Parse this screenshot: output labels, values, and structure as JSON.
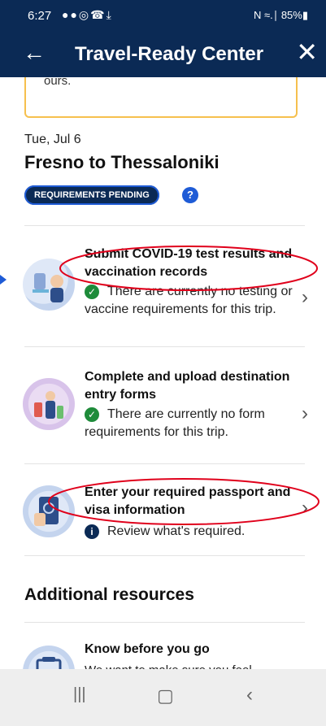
{
  "status": {
    "time": "6:27",
    "left_icons": "●●◎☎⤓",
    "right": "N ≈.∣ 85%▮"
  },
  "header": {
    "back_glyph": "←",
    "title": "Travel-Ready Center",
    "close_glyph": "✕"
  },
  "notice": {
    "text": "ours."
  },
  "trip": {
    "date": "Tue, Jul 6",
    "route": "Fresno to Thessaloniki",
    "badge": "REQUIREMENTS PENDING",
    "help_glyph": "?"
  },
  "tasks": [
    {
      "title": "Submit COVID-19 test results and vaccination records",
      "status_icon": "check-icon",
      "desc": "There are currently no testing or vaccine requirements for this trip."
    },
    {
      "title": "Complete and upload destination entry forms",
      "status_icon": "check-icon",
      "desc": "There are currently no form requirements for this trip."
    },
    {
      "title": "Enter your required passport and visa information",
      "status_icon": "info-icon",
      "desc": "Review what's required."
    }
  ],
  "resources": {
    "heading": "Additional resources",
    "items": [
      {
        "title": "Know before you go",
        "desc": "We want to make sure you feel"
      }
    ]
  },
  "colors": {
    "brand": "#0b2a55",
    "accent": "#1e5bd6",
    "success": "#1e8b3a",
    "highlight": "#e0001b"
  }
}
